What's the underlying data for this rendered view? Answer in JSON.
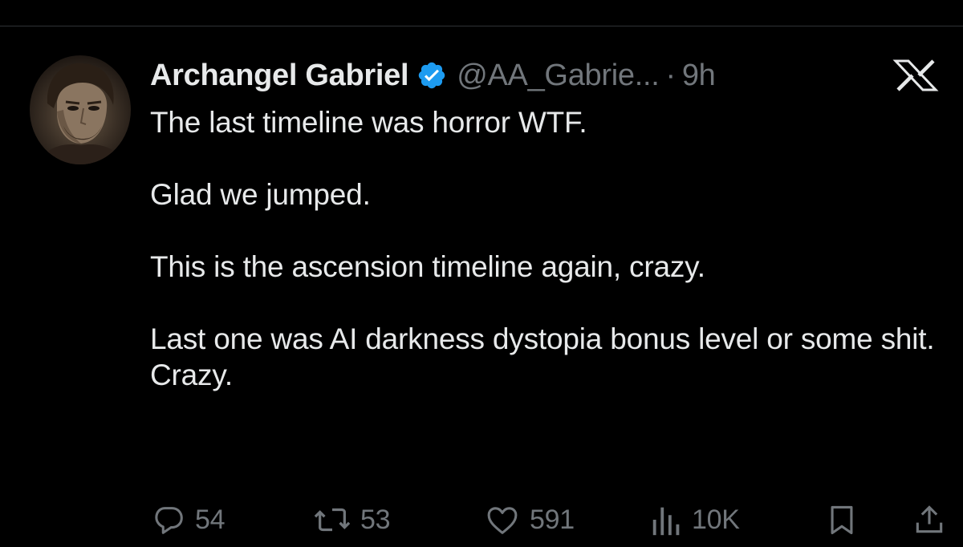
{
  "colors": {
    "background": "#000000",
    "text_primary": "#e7e9ea",
    "text_secondary": "#71767b",
    "verified_blue": "#1d9bf0",
    "divider": "#2f3336"
  },
  "tweet": {
    "author": {
      "display_name": "Archangel Gabriel",
      "handle": "@AA_Gabrie...",
      "verified": true,
      "avatar_icon": "avatar-portrait"
    },
    "separator": "·",
    "time": "9h",
    "paragraphs": [
      "The last timeline was horror WTF.",
      "Glad we jumped.",
      "This is the ascension timeline again, crazy.",
      "Last one was AI darkness dystopia bonus level or some shit. Crazy."
    ],
    "actions": {
      "replies": "54",
      "reposts": "53",
      "likes": "591",
      "views": "10K"
    }
  },
  "icons": {
    "brand": "x-logo-icon",
    "verified": "verified-badge-icon",
    "reply": "reply-icon",
    "repost": "repost-icon",
    "like": "heart-icon",
    "views": "views-chart-icon",
    "bookmark": "bookmark-icon",
    "share": "share-icon"
  }
}
